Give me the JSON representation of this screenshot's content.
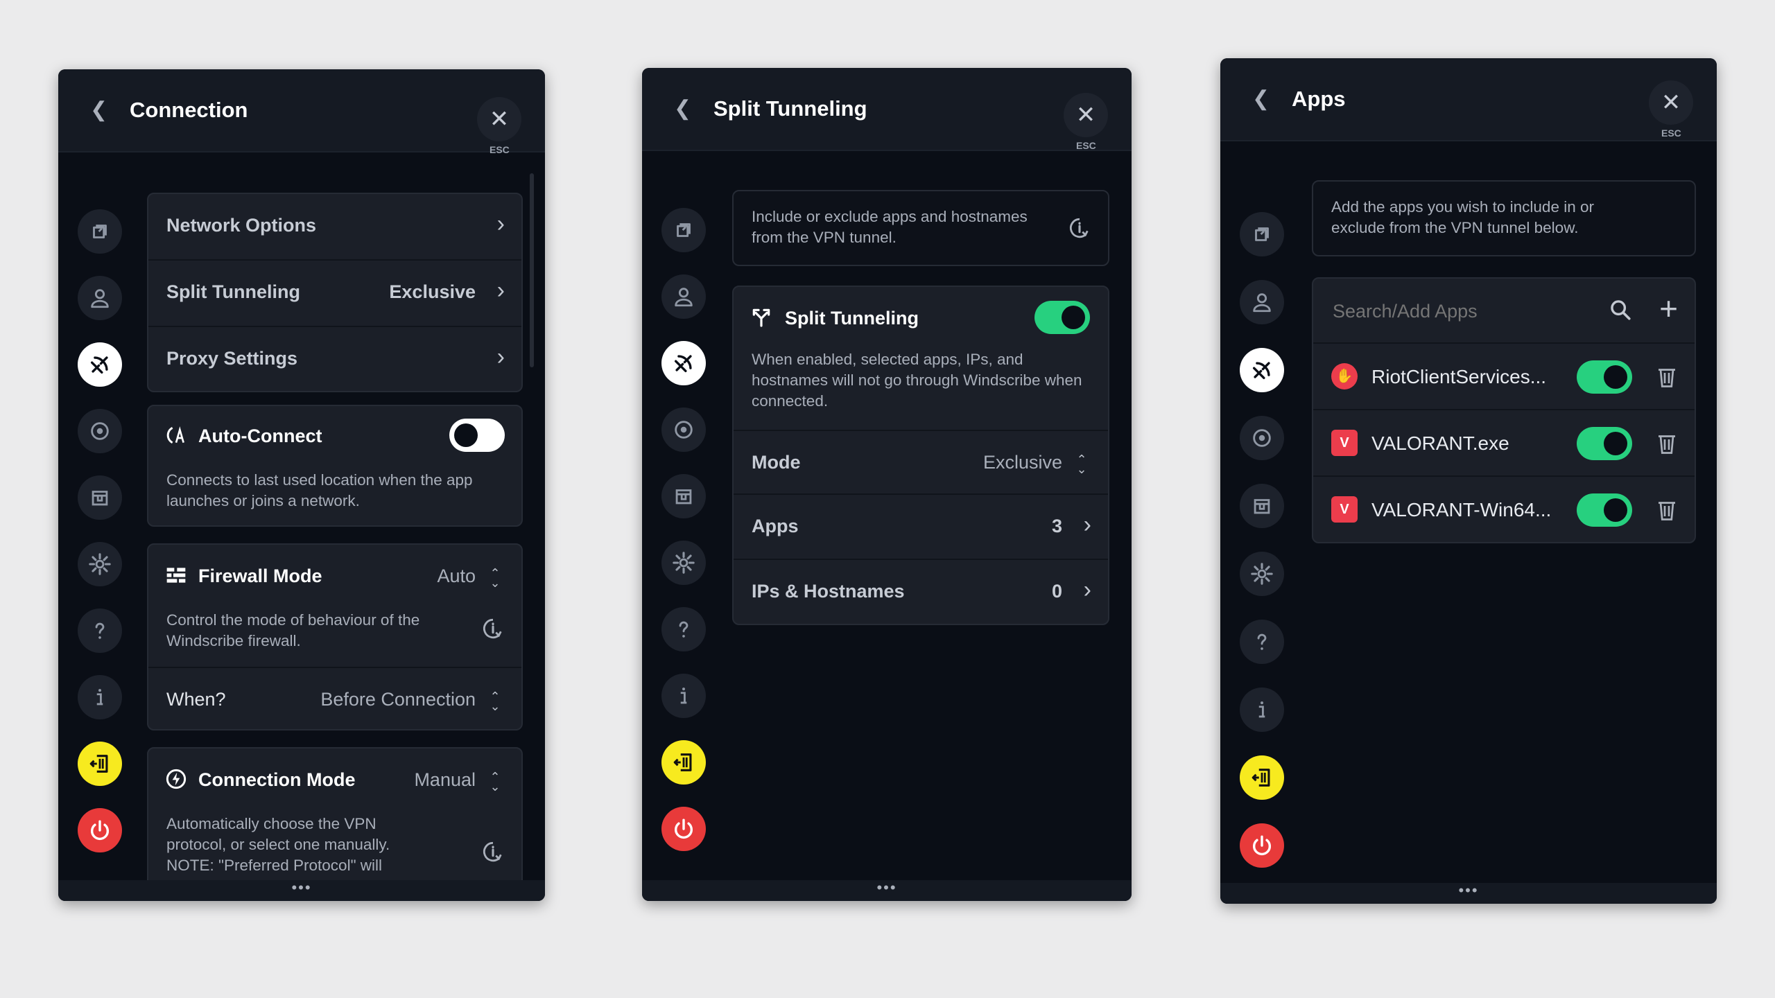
{
  "panel_connection": {
    "title": "Connection",
    "esc_label": "ESC",
    "rows": [
      {
        "label": "Network Options",
        "value": ""
      },
      {
        "label": "Split Tunneling",
        "value": "Exclusive"
      },
      {
        "label": "Proxy Settings",
        "value": ""
      }
    ],
    "auto_connect": {
      "title": "Auto-Connect",
      "enabled": false,
      "description": "Connects to last used location when the app launches or joins a network."
    },
    "firewall": {
      "title": "Firewall Mode",
      "value": "Auto",
      "description": "Control the mode of behaviour of the Windscribe firewall.",
      "when_label": "When?",
      "when_value": "Before Connection"
    },
    "connection_mode": {
      "title": "Connection Mode",
      "value": "Manual",
      "description_line1": "Automatically choose the VPN",
      "description_line2": "protocol, or select one manually.",
      "description_line3": "NOTE: \"Preferred Protocol\" will"
    },
    "footer": "•••"
  },
  "panel_split": {
    "title": "Split Tunneling",
    "esc_label": "ESC",
    "intro": "Include or exclude apps and hostnames from the VPN tunnel.",
    "toggle_title": "Split Tunneling",
    "enabled": true,
    "description": "When enabled, selected apps, IPs, and hostnames will not go through Windscribe when connected.",
    "mode_label": "Mode",
    "mode_value": "Exclusive",
    "apps_label": "Apps",
    "apps_count": "3",
    "ips_label": "IPs & Hostnames",
    "ips_count": "0",
    "footer": "•••"
  },
  "panel_apps": {
    "title": "Apps",
    "esc_label": "ESC",
    "intro": "Add the apps you wish to include in or exclude from the VPN tunnel below.",
    "search_placeholder": "Search/Add Apps",
    "apps": [
      {
        "name": "RiotClientServices...",
        "enabled": true,
        "icon": "riot-fist-icon"
      },
      {
        "name": "VALORANT.exe",
        "enabled": true,
        "icon": "valorant-icon"
      },
      {
        "name": "VALORANT-Win64...",
        "enabled": true,
        "icon": "valorant-icon"
      }
    ],
    "footer": "•••"
  },
  "sidebar_icons": [
    "connection-icon",
    "account-icon",
    "split-tunnel-icon",
    "robert-icon",
    "preferences-box-icon",
    "settings-gear-icon",
    "help-icon",
    "about-icon",
    "logout-icon",
    "power-icon"
  ],
  "colors": {
    "panel_bg": "#0a0e16",
    "card_bg": "#1b1f28",
    "toggle_on": "#27d07f",
    "logout_yellow": "#f7ea1f",
    "power_red": "#e83a3a"
  }
}
